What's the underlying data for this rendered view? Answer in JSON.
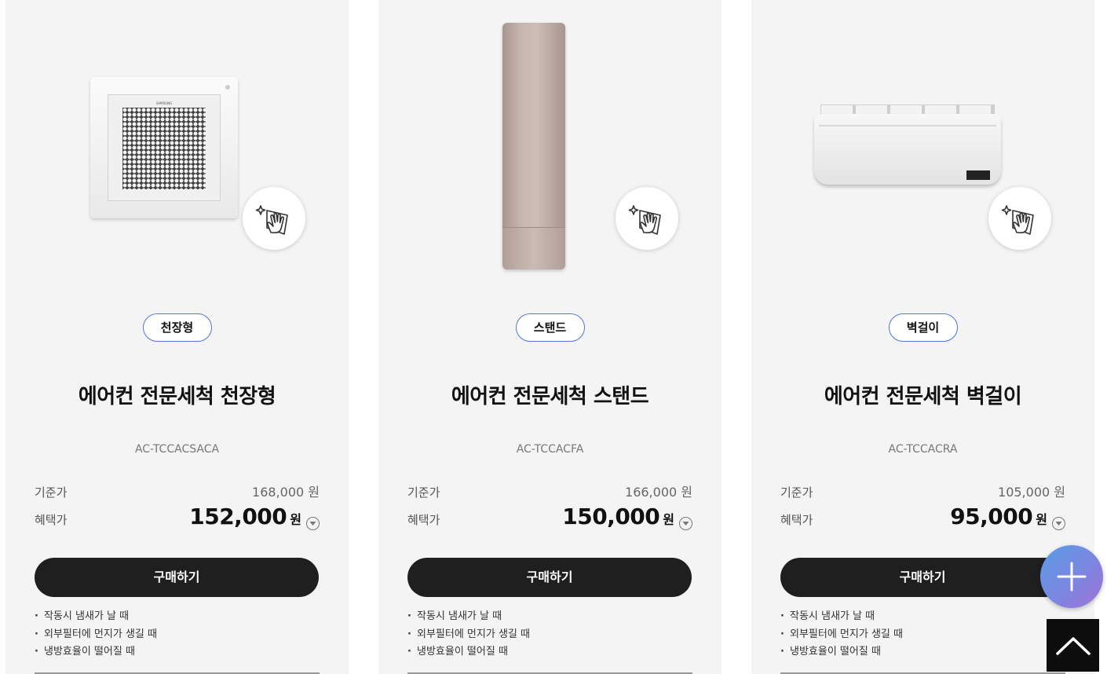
{
  "products": [
    {
      "type_tag": "천장형",
      "title": "에어컨 전문세척 천장형",
      "model": "AC-TCCACSACA",
      "base_label": "기준가",
      "base_price": "168,000 원",
      "benefit_label": "혜택가",
      "benefit_price": "152,000",
      "benefit_unit": "원",
      "buy_label": "구매하기",
      "bullets": [
        "작동시 냄새가 날 때",
        "외부필터에 먼지가 생길 때",
        "냉방효율이 떨어질 때"
      ]
    },
    {
      "type_tag": "스탠드",
      "title": "에어컨 전문세척 스탠드",
      "model": "AC-TCCACFA",
      "base_label": "기준가",
      "base_price": "166,000 원",
      "benefit_label": "혜택가",
      "benefit_price": "150,000",
      "benefit_unit": "원",
      "buy_label": "구매하기",
      "bullets": [
        "작동시 냄새가 날 때",
        "외부필터에 먼지가 생길 때",
        "냉방효율이 떨어질 때"
      ]
    },
    {
      "type_tag": "벽걸이",
      "title": "에어컨 전문세척 벽걸이",
      "model": "AC-TCCACRA",
      "base_label": "기준가",
      "base_price": "105,000 원",
      "benefit_label": "혜택가",
      "benefit_price": "95,000",
      "benefit_unit": "원",
      "buy_label": "구매하기",
      "bullets": [
        "작동시 냄새가 날 때",
        "외부필터에 먼지가 생길 때",
        "냉방효율이 떨어질 때"
      ]
    }
  ],
  "icons": {
    "clean_badge": "cleaning-hand-icon",
    "info": "chevron-down-circle-icon",
    "fab": "plus-icon",
    "scroll_top": "chevron-up-icon"
  },
  "colors": {
    "card_bg": "#f4f4f4",
    "tag_border": "#4f76d9",
    "button_bg": "#1f1f1f",
    "fab_gradient_start": "#5a9ce6",
    "fab_gradient_end": "#a173d6"
  }
}
